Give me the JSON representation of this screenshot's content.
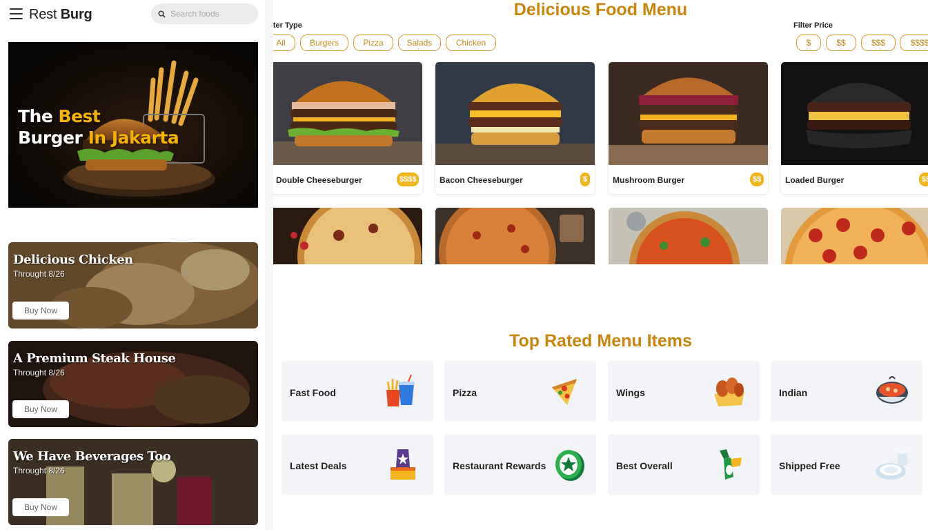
{
  "header": {
    "brand_part1": "Rest",
    "brand_part2": "Burg",
    "search_placeholder": "Search foods"
  },
  "hero": {
    "line1_white": "The ",
    "line1_yellow": "Best",
    "line2_white": "Burger ",
    "line2_yellow": "In Jakarta"
  },
  "promos": [
    {
      "title": "Delicious Chicken",
      "subtitle": "Throught 8/26",
      "button": "Buy Now"
    },
    {
      "title": "A Premium Steak House",
      "subtitle": "Throught 8/26",
      "button": "Buy Now"
    },
    {
      "title": "We Have Beverages Too",
      "subtitle": "Throught 8/26",
      "button": "Buy Now"
    }
  ],
  "menu": {
    "title": "Delicious Food Menu",
    "filter_type_label": "Filter Type",
    "filter_price_label": "Filter Price",
    "type_filters": [
      "All",
      "Burgers",
      "Pizza",
      "Salads",
      "Chicken"
    ],
    "price_filters": [
      "$",
      "$$",
      "$$$",
      "$$$$"
    ],
    "items": [
      {
        "name": "Double Cheeseburger",
        "price": "$$$$"
      },
      {
        "name": "Bacon Cheeseburger",
        "price": "$"
      },
      {
        "name": "Mushroom Burger",
        "price": "$$"
      },
      {
        "name": "Loaded Burger",
        "price": "$$"
      }
    ]
  },
  "top_rated": {
    "title": "Top Rated Menu Items",
    "categories": [
      {
        "label": "Fast Food",
        "icon": "fast-food-icon"
      },
      {
        "label": "Pizza",
        "icon": "pizza-slice-icon"
      },
      {
        "label": "Wings",
        "icon": "chicken-wings-icon"
      },
      {
        "label": "Indian",
        "icon": "curry-bowl-icon"
      },
      {
        "label": "Latest Deals",
        "icon": "deal-tag-icon"
      },
      {
        "label": "Restaurant Rewards",
        "icon": "reward-coin-icon"
      },
      {
        "label": "Best Overall",
        "icon": "best-sauce-icon"
      },
      {
        "label": "Shipped Free",
        "icon": "plate-icon"
      }
    ]
  },
  "colors": {
    "accent": "#c8870c",
    "badge": "#f2b51b",
    "hero_yellow": "#f5b301",
    "tile_bg": "#f2f4f7"
  }
}
